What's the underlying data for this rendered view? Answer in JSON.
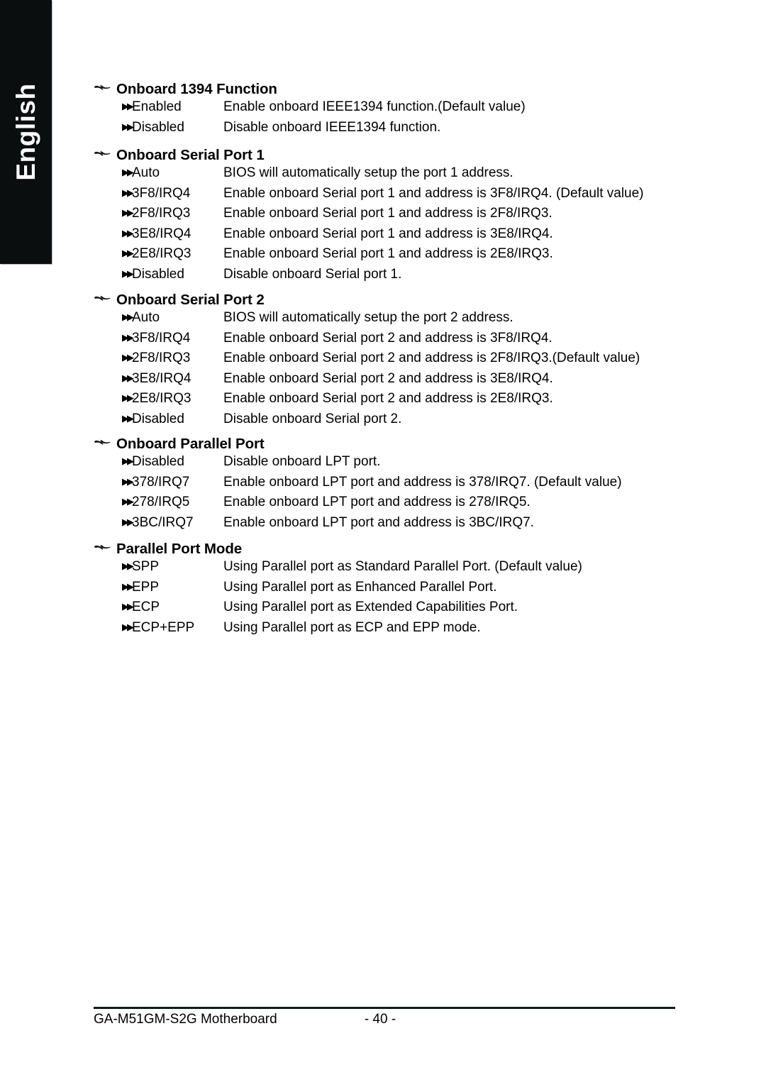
{
  "side_tab": {
    "label": "English",
    "background": "#0a0e0e",
    "text_color": "#ffffff"
  },
  "icons": {
    "heading_bullet": "pointing-hand-icon",
    "option_bullet": "double-triangle-right-icon"
  },
  "sections": [
    {
      "title": "Onboard 1394 Function",
      "options": [
        {
          "name": "Enabled",
          "desc": "Enable onboard IEEE1394 function.(Default value)"
        },
        {
          "name": "Disabled",
          "desc": "Disable onboard IEEE1394 function."
        }
      ]
    },
    {
      "title": "Onboard Serial Port 1",
      "options": [
        {
          "name": "Auto",
          "desc": "BIOS will automatically setup the port 1 address."
        },
        {
          "name": "3F8/IRQ4",
          "desc": "Enable onboard Serial port 1 and address is 3F8/IRQ4. (Default value)"
        },
        {
          "name": "2F8/IRQ3",
          "desc": "Enable onboard Serial port 1 and address is 2F8/IRQ3."
        },
        {
          "name": "3E8/IRQ4",
          "desc": "Enable onboard Serial port 1 and address is 3E8/IRQ4."
        },
        {
          "name": "2E8/IRQ3",
          "desc": "Enable onboard Serial port 1 and address is 2E8/IRQ3."
        },
        {
          "name": "Disabled",
          "desc": "Disable onboard Serial port 1."
        }
      ]
    },
    {
      "title": "Onboard Serial Port 2",
      "options": [
        {
          "name": "Auto",
          "desc": "BIOS will automatically setup the port 2 address."
        },
        {
          "name": "3F8/IRQ4",
          "desc": "Enable onboard Serial port 2 and address is 3F8/IRQ4."
        },
        {
          "name": "2F8/IRQ3",
          "desc": "Enable onboard Serial port 2 and address is 2F8/IRQ3.(Default value)"
        },
        {
          "name": "3E8/IRQ4",
          "desc": "Enable onboard Serial port 2 and address is 3E8/IRQ4."
        },
        {
          "name": "2E8/IRQ3",
          "desc": "Enable onboard Serial port 2 and address is 2E8/IRQ3."
        },
        {
          "name": "Disabled",
          "desc": "Disable onboard Serial port 2."
        }
      ]
    },
    {
      "title": "Onboard Parallel Port",
      "options": [
        {
          "name": "Disabled",
          "desc": "Disable onboard LPT port."
        },
        {
          "name": "378/IRQ7",
          "desc": "Enable onboard LPT port and address is 378/IRQ7. (Default value)"
        },
        {
          "name": "278/IRQ5",
          "desc": "Enable onboard LPT port and address is 278/IRQ5."
        },
        {
          "name": "3BC/IRQ7",
          "desc": "Enable onboard LPT port and address is 3BC/IRQ7."
        }
      ]
    },
    {
      "title": "Parallel Port Mode",
      "options": [
        {
          "name": "SPP",
          "desc": "Using Parallel port as Standard Parallel Port. (Default value)"
        },
        {
          "name": "EPP",
          "desc": "Using Parallel port as Enhanced Parallel Port."
        },
        {
          "name": "ECP",
          "desc": "Using Parallel port as Extended Capabilities Port."
        },
        {
          "name": "ECP+EPP",
          "desc": "Using Parallel port as ECP and EPP mode."
        }
      ]
    }
  ],
  "footer": {
    "left": "GA-M51GM-S2G Motherboard",
    "page": "- 40 -"
  }
}
